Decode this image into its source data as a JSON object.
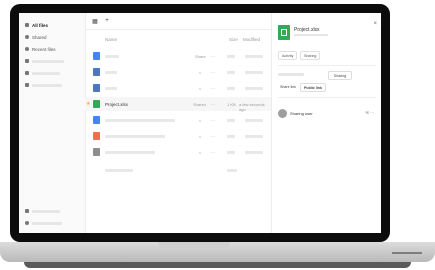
{
  "sidebar": {
    "items": [
      {
        "label": "All files",
        "icon": "folder-icon"
      },
      {
        "label": "Shared",
        "icon": "share-icon"
      },
      {
        "label": "Recent files",
        "icon": "clock-icon"
      },
      {
        "label": "",
        "icon": "link-icon"
      },
      {
        "label": "",
        "icon": "tag-icon"
      },
      {
        "label": "",
        "icon": "search-icon"
      }
    ],
    "bottom_items": [
      {
        "label": "",
        "icon": "trash-icon"
      },
      {
        "label": "",
        "icon": "gear-icon"
      }
    ]
  },
  "toolbar": {
    "home_icon": "grid-icon",
    "add_icon": "plus-icon"
  },
  "columns": {
    "name": "Name",
    "size": "Size",
    "modified": "Modified"
  },
  "files": [
    {
      "name": "",
      "type": "doc",
      "share": "Share",
      "size": "",
      "modified": ""
    },
    {
      "name": "",
      "type": "folder",
      "share": "",
      "size": "",
      "modified": ""
    },
    {
      "name": "",
      "type": "folder",
      "share": "",
      "size": "",
      "modified": ""
    },
    {
      "name": "Project.xlsx",
      "type": "sheet",
      "share": "Shared",
      "size": "1 KB",
      "modified": "a few seconds ago",
      "selected": true
    },
    {
      "name": "",
      "type": "doc",
      "share": "",
      "size": "",
      "modified": ""
    },
    {
      "name": "",
      "type": "slides",
      "share": "",
      "size": "",
      "modified": ""
    },
    {
      "name": "",
      "type": "image",
      "share": "",
      "size": "",
      "modified": ""
    }
  ],
  "panel": {
    "title": "Project.xlsx",
    "chips": [
      "Activity",
      "Sharing"
    ],
    "buttons": [
      "Sharing",
      "Share link",
      "Public link"
    ],
    "share_label": "Sharing user",
    "share_actions": "✉ ⋯"
  },
  "colors": {
    "folder": "#4a78c0",
    "sheet": "#34a853",
    "doc": "#4285f4",
    "slides": "#f4b400"
  }
}
